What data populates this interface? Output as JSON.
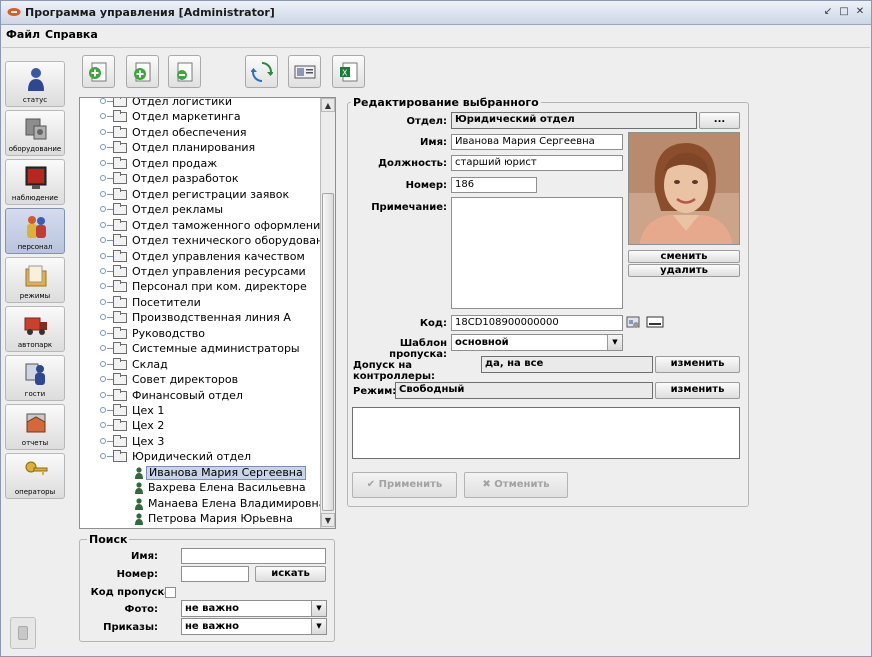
{
  "window": {
    "title": "Программа управления [Administrator]"
  },
  "menu": [
    "Файл",
    "Справка"
  ],
  "sidebar": [
    {
      "label": "статус",
      "icon": "person-status-icon"
    },
    {
      "label": "оборудование",
      "icon": "equipment-icon"
    },
    {
      "label": "наблюдение",
      "icon": "monitoring-icon"
    },
    {
      "label": "персонал",
      "icon": "personnel-icon",
      "active": true
    },
    {
      "label": "режимы",
      "icon": "folder-modes-icon"
    },
    {
      "label": "автопарк",
      "icon": "truck-icon"
    },
    {
      "label": "гости",
      "icon": "guests-icon"
    },
    {
      "label": "отчеты",
      "icon": "reports-icon"
    },
    {
      "label": "операторы",
      "icon": "key-icon"
    }
  ],
  "toolbar": [
    {
      "name": "add-department-button",
      "icon": "add-folder-icon"
    },
    {
      "name": "add-employee-button",
      "icon": "add-document-icon"
    },
    {
      "name": "delete-button",
      "icon": "remove-document-icon"
    },
    {
      "name": "refresh-button",
      "icon": "refresh-icon"
    },
    {
      "name": "card-button",
      "icon": "id-card-icon"
    },
    {
      "name": "export-excel-button",
      "icon": "excel-icon"
    }
  ],
  "tree": {
    "departments": [
      "Отдел логистики",
      "Отдел маркетинга",
      "Отдел обеспечения",
      "Отдел планирования",
      "Отдел продаж",
      "Отдел разработок",
      "Отдел регистрации заявок",
      "Отдел рекламы",
      "Отдел таможенного оформления",
      "Отдел технического оборудования",
      "Отдел управления качеством",
      "Отдел управления ресурсами",
      "Персонал при ком. директоре",
      "Посетители",
      "Производственная линия А",
      "Руководство",
      "Системные администраторы",
      "Склад",
      "Совет директоров",
      "Финансовый отдел",
      "Цех 1",
      "Цех 2",
      "Цех 3"
    ],
    "expanded": "Юридический отдел",
    "employees": [
      "Иванова Мария Сергеевна",
      "Вахрева Елена Васильевна",
      "Манаева Елена Владимировна",
      "Петрова Мария Юрьевна"
    ],
    "selected_index": 0
  },
  "search": {
    "title": "Поиск",
    "name_label": "Имя:",
    "name_value": "",
    "number_label": "Номер:",
    "number_value": "",
    "search_button": "искать",
    "code_label": "Код пропуска:",
    "photo_label": "Фото:",
    "photo_value": "не важно",
    "orders_label": "Приказы:",
    "orders_value": "не важно"
  },
  "editor": {
    "title": "Редактирование выбранного",
    "dept_label": "Отдел:",
    "dept_value": "Юридический отдел",
    "dept_browse": "...",
    "name_label": "Имя:",
    "name_value": "Иванова Мария Сергеевна",
    "position_label": "Должность:",
    "position_value": "старший юрист",
    "number_label": "Номер:",
    "number_value": "186",
    "note_label": "Примечание:",
    "note_value": "",
    "photo_change": "сменить",
    "photo_delete": "удалить",
    "code_label": "Код:",
    "code_value": "18CD108900000000",
    "template_label": "Шаблон пропуска:",
    "template_value": "основной",
    "access_label": "Допуск на контроллеры:",
    "access_value": "да, на все",
    "access_change": "изменить",
    "mode_label": "Режим:",
    "mode_value": "Свободный",
    "mode_change": "изменить",
    "apply": "Применить",
    "cancel": "Отменить"
  }
}
